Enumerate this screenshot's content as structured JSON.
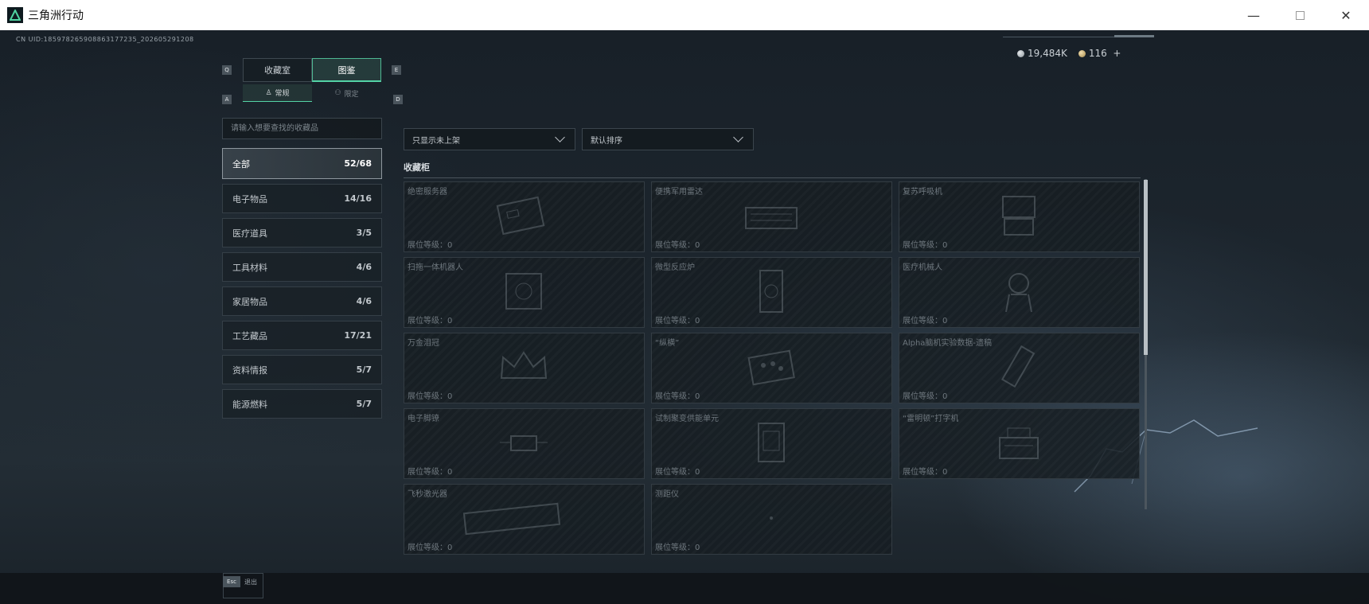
{
  "window": {
    "title": "三角洲行动",
    "minimize": "—",
    "close": "✕"
  },
  "header": {
    "uid": "CN UID:185978265908863177235_202605291208",
    "currency_silver": "19,484K",
    "currency_gold": "116",
    "add": "+"
  },
  "keys": {
    "q": "Q",
    "e": "E",
    "a": "A",
    "d": "D",
    "esc": "Esc"
  },
  "main_tabs": [
    {
      "label": "收藏室"
    },
    {
      "label": "图鉴"
    }
  ],
  "sub_tabs": [
    {
      "label": "常规"
    },
    {
      "label": "限定"
    }
  ],
  "search": {
    "placeholder": "请输入想要查找的收藏品"
  },
  "filters": {
    "shelf": "只显示未上架",
    "sort": "默认排序"
  },
  "categories": [
    {
      "label": "全部",
      "count": "52/68"
    },
    {
      "label": "电子物品",
      "count": "14/16"
    },
    {
      "label": "医疗道具",
      "count": "3/5"
    },
    {
      "label": "工具材料",
      "count": "4/6"
    },
    {
      "label": "家居物品",
      "count": "4/6"
    },
    {
      "label": "工艺藏品",
      "count": "17/21"
    },
    {
      "label": "资料情报",
      "count": "5/7"
    },
    {
      "label": "能源燃料",
      "count": "5/7"
    }
  ],
  "section": {
    "title": "收藏柜"
  },
  "cards": [
    {
      "name": "绝密服务器",
      "level": "展位等级：0"
    },
    {
      "name": "便携军用雷达",
      "level": "展位等级：0"
    },
    {
      "name": "复苏呼吸机",
      "level": "展位等级：0"
    },
    {
      "name": "扫拖一体机器人",
      "level": "展位等级：0"
    },
    {
      "name": "微型反应炉",
      "level": "展位等级：0"
    },
    {
      "name": "医疗机械人",
      "level": "展位等级：0"
    },
    {
      "name": "万金泪冠",
      "level": "展位等级：0"
    },
    {
      "name": "“纵横”",
      "level": "展位等级：0"
    },
    {
      "name": "Alpha脑机实验数据-遗稿",
      "level": "展位等级：0"
    },
    {
      "name": "电子脚镣",
      "level": "展位等级：0"
    },
    {
      "name": "试制聚变供能单元",
      "level": "展位等级：0"
    },
    {
      "name": "“雷明顿”打字机",
      "level": "展位等级：0"
    },
    {
      "name": "飞秒激光器",
      "level": "展位等级：0"
    },
    {
      "name": "测距仪",
      "level": "展位等级：0"
    }
  ],
  "footer": {
    "back_label": "退出"
  }
}
